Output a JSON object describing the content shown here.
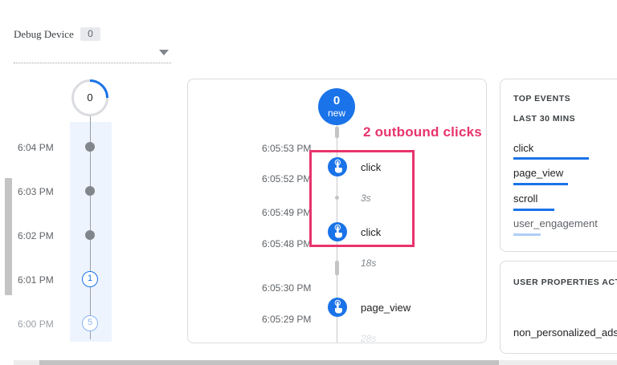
{
  "debug_device": {
    "label": "Debug Device",
    "count": "0"
  },
  "minutes": {
    "top_count": "0",
    "items": [
      {
        "time": "6:04 PM"
      },
      {
        "time": "6:03 PM"
      },
      {
        "time": "6:02 PM"
      },
      {
        "time": "6:01 PM",
        "count": "1"
      },
      {
        "time": "6:00 PM",
        "count": "5"
      }
    ]
  },
  "seconds": {
    "new_count": "0",
    "new_label": "new",
    "times": [
      "6:05:53 PM",
      "6:05:52 PM",
      "6:05:49 PM",
      "6:05:48 PM",
      "6:05:30 PM",
      "6:05:29 PM"
    ],
    "events": [
      {
        "name": "click",
        "icon": "touch-icon"
      },
      {
        "name": "click",
        "icon": "touch-icon"
      },
      {
        "name": "page_view",
        "icon": "touch-icon"
      }
    ],
    "gaps": [
      "3s",
      "18s",
      "28s"
    ]
  },
  "annotation": {
    "text": "2 outbound clicks",
    "color": "#e8336c"
  },
  "top_events": {
    "title": "TOP EVENTS",
    "subtitle": "LAST 30 MINS",
    "items": [
      {
        "name": "click",
        "share": 0.55
      },
      {
        "name": "page_view",
        "share": 0.4
      },
      {
        "name": "scroll",
        "share": 0.3
      },
      {
        "name": "user_engagement",
        "share": 0.2
      }
    ]
  },
  "user_properties": {
    "title": "USER PROPERTIES ACTI",
    "items": [
      "non_personalized_ads"
    ]
  },
  "colors": {
    "accent": "#1a73e8",
    "annotation": "#e8336c"
  }
}
